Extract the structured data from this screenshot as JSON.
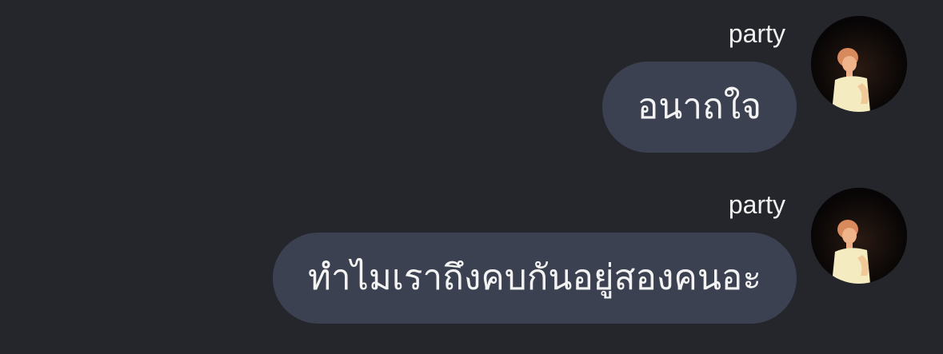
{
  "messages": [
    {
      "sender": "party",
      "text": "อนาถใจ",
      "avatar": "person-avatar"
    },
    {
      "sender": "party",
      "text": "ทำไมเราถึงคบกันอยู่สองคนอะ",
      "avatar": "person-avatar"
    }
  ],
  "colors": {
    "background": "#24262b",
    "bubble": "#3b4150",
    "text": "#f3f3f3"
  }
}
